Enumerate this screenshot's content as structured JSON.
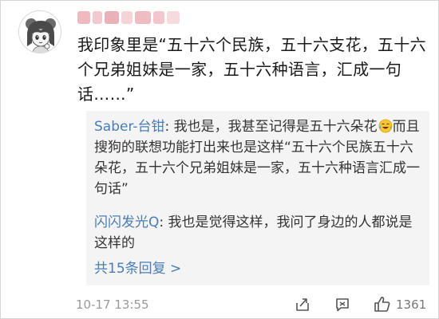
{
  "comment": {
    "text": "我印象里是“五十六个民族，五十六支花，五十六个兄弟姐妹是一家，五十六种语言，汇成一句话……”",
    "timestamp": "10-17 13:55",
    "like_count": "1361"
  },
  "replies": [
    {
      "author": "Saber-台钳",
      "separator": ": ",
      "text_before_emoji": "我也是，我甚至记得是五十六朵花",
      "emoji": "laugh-cry-emoji",
      "text_after_emoji": "而且搜狗的联想功能打出来也是这样“五十六个民族五十六朵花，五十六个兄弟姐妹是一家，五十六种语言汇成一句话”"
    },
    {
      "author": "闪闪发光Q",
      "separator": ": ",
      "text": "我也是觉得这样，我问了身边的人都说是这样的"
    }
  ],
  "reply_summary": "共15条回复 >",
  "colors": {
    "link": "#4a7cb5",
    "meta": "#9a9a9a",
    "reply_bg": "#f4f4f4"
  }
}
